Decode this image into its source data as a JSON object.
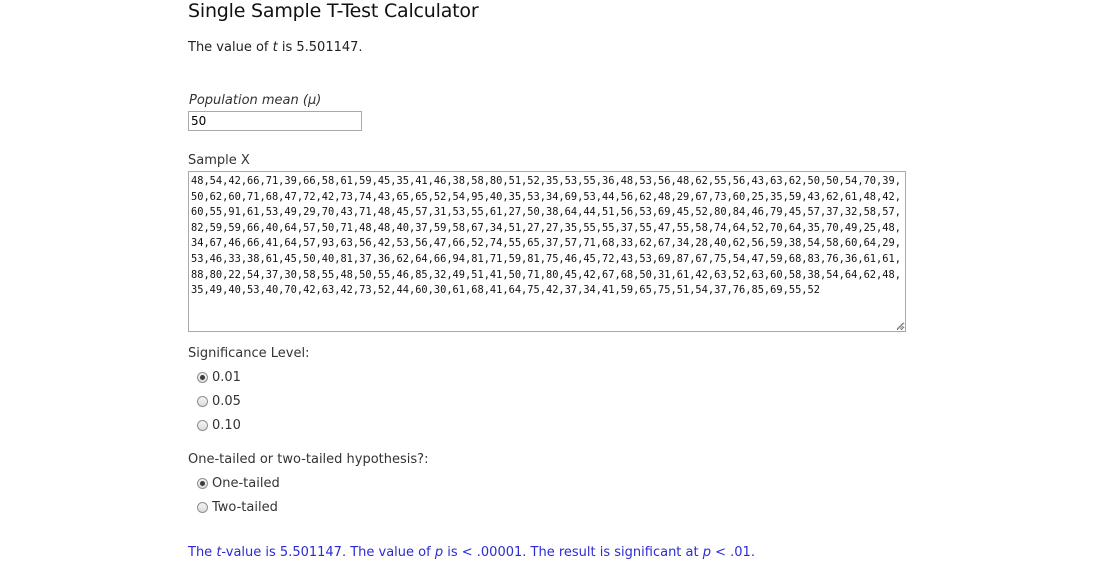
{
  "page": {
    "title": "Single Sample T-Test Calculator"
  },
  "t_line": {
    "prefix": "The value of ",
    "var": "t",
    "suffix": " is 5.501147."
  },
  "mean": {
    "label": "Population mean (μ)",
    "value": "50"
  },
  "sample": {
    "label": "Sample X",
    "value": "48,54,42,66,71,39,66,58,61,59,45,35,41,46,38,58,80,51,52,35,53,55,36,48,53,56,48,62,55,56,43,63,62,50,50,54,70,39,50,62,60,71,68,47,72,42,73,74,43,65,65,52,54,95,40,35,53,34,69,53,44,56,62,48,29,67,73,60,25,35,59,43,62,61,48,42,60,55,91,61,53,49,29,70,43,71,48,45,57,31,53,55,61,27,50,38,64,44,51,56,53,69,45,52,80,84,46,79,45,57,37,32,58,57,82,59,59,66,40,64,57,50,71,48,48,40,37,59,58,67,34,51,27,27,35,55,55,37,55,47,55,58,74,64,52,70,64,35,70,49,25,48,34,67,46,66,41,64,57,93,63,56,42,53,56,47,66,52,74,55,65,37,57,71,68,33,62,67,34,28,40,62,56,59,38,54,58,60,64,29,53,46,33,38,61,45,50,40,81,37,36,62,64,66,94,81,71,59,81,75,46,45,72,43,53,69,87,67,75,54,47,59,68,83,76,36,61,61,88,80,22,54,37,30,58,55,48,50,55,46,85,32,49,51,41,50,71,80,45,42,67,68,50,31,61,42,63,52,63,60,58,38,54,64,62,48,35,49,40,53,40,70,42,63,42,73,52,44,60,30,61,68,41,64,75,42,37,34,41,59,65,75,51,54,37,76,85,69,55,52"
  },
  "significance": {
    "label": "Significance Level:",
    "options": [
      "0.01",
      "0.05",
      "0.10"
    ],
    "selected": "0.01"
  },
  "tails": {
    "label": "One-tailed or two-tailed hypothesis?:",
    "options": [
      "One-tailed",
      "Two-tailed"
    ],
    "selected": "One-tailed"
  },
  "result": {
    "p1": "The ",
    "v1": "t",
    "p2": "-value is 5.501147. The value of ",
    "v2": "p",
    "p3": " is < .00001. The result is significant at ",
    "v3": "p",
    "p4": " < .01."
  },
  "colors": {
    "result_text": "#2b2bd1",
    "body_text": "#333333"
  }
}
